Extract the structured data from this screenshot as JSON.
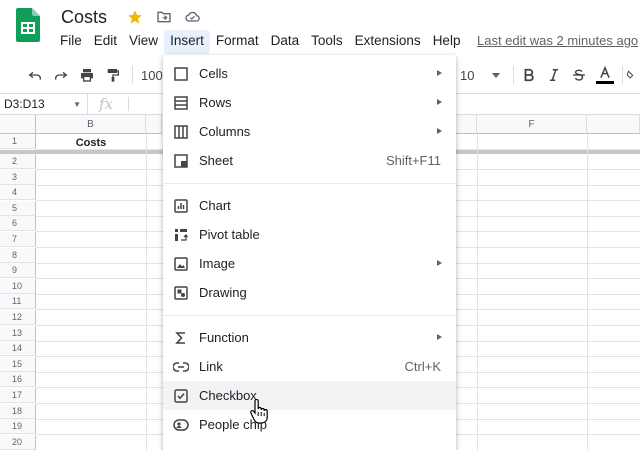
{
  "header": {
    "doc_title": "Costs",
    "last_edit": "Last edit was 2 minutes ago",
    "icons": [
      "star-icon",
      "move-to-folder-icon",
      "cloud-saved-icon"
    ],
    "star_color": "#f4b400"
  },
  "menubar": {
    "items": [
      {
        "label": "File"
      },
      {
        "label": "Edit"
      },
      {
        "label": "View"
      },
      {
        "label": "Insert",
        "active": true
      },
      {
        "label": "Format"
      },
      {
        "label": "Data"
      },
      {
        "label": "Tools"
      },
      {
        "label": "Extensions"
      },
      {
        "label": "Help"
      }
    ]
  },
  "toolbar": {
    "zoom": "100",
    "font_size": "10",
    "icons": [
      "undo-icon",
      "redo-icon",
      "print-icon",
      "paint-format-icon",
      "bold-icon",
      "italic-icon",
      "strikethrough-icon",
      "text-color-icon",
      "fill-color-icon"
    ]
  },
  "formula_bar": {
    "name_box": "D3:D13",
    "fx": "fx"
  },
  "grid": {
    "columns": [
      "B",
      "F"
    ],
    "rows": [
      "1",
      "2",
      "3",
      "4",
      "5",
      "6",
      "7",
      "8",
      "9",
      "10",
      "11",
      "12",
      "13",
      "14",
      "15",
      "16",
      "17",
      "18",
      "19",
      "20"
    ],
    "cell_b1": "Costs"
  },
  "insert_menu": {
    "items": [
      {
        "label": "Cells",
        "icon": "cells-icon",
        "submenu": true
      },
      {
        "label": "Rows",
        "icon": "rows-icon",
        "submenu": true
      },
      {
        "label": "Columns",
        "icon": "columns-icon",
        "submenu": true
      },
      {
        "label": "Sheet",
        "icon": "sheet-icon",
        "shortcut": "Shift+F11"
      },
      {
        "label": "Chart",
        "icon": "chart-icon"
      },
      {
        "label": "Pivot table",
        "icon": "pivot-table-icon"
      },
      {
        "label": "Image",
        "icon": "image-icon",
        "submenu": true
      },
      {
        "label": "Drawing",
        "icon": "drawing-icon"
      },
      {
        "label": "Function",
        "icon": "function-icon",
        "submenu": true
      },
      {
        "label": "Link",
        "icon": "link-icon",
        "shortcut": "Ctrl+K"
      },
      {
        "label": "Checkbox",
        "icon": "checkbox-icon",
        "hovered": true
      },
      {
        "label": "People chip",
        "icon": "people-chip-icon"
      }
    ]
  },
  "colors": {
    "sheets_green": "#0f9d58",
    "menu_active_bg": "#e8f0fe",
    "hover_bg": "#f1f3f4",
    "grid_line": "#e2e3e3"
  }
}
